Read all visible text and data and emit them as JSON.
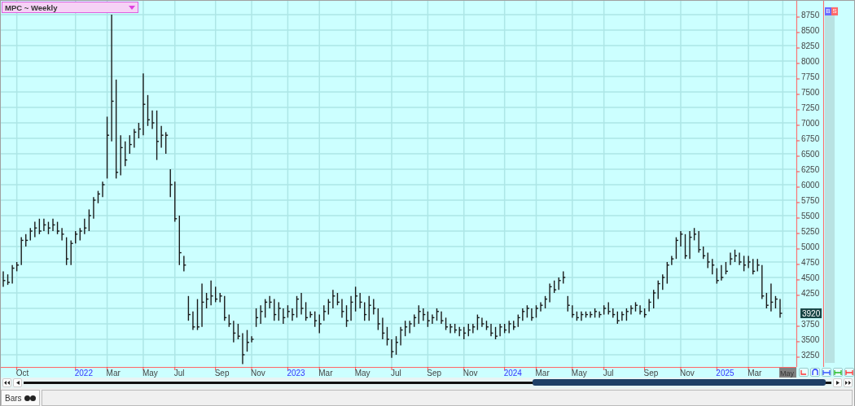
{
  "header": {
    "title": "MPC ~ Weekly"
  },
  "price_axis": [
    "8750",
    "8500",
    "8250",
    "8000",
    "7750",
    "7500",
    "7250",
    "7000",
    "6750",
    "6500",
    "6250",
    "6000",
    "5750",
    "5500",
    "5250",
    "5000",
    "4750",
    "4500",
    "4250",
    "3750",
    "3500",
    "3250"
  ],
  "time_axis": [
    {
      "label": "Oct",
      "kind": "month"
    },
    {
      "label": "2022",
      "kind": "year"
    },
    {
      "label": "Mar",
      "kind": "month"
    },
    {
      "label": "May",
      "kind": "month"
    },
    {
      "label": "Jul",
      "kind": "month"
    },
    {
      "label": "Sep",
      "kind": "month"
    },
    {
      "label": "Nov",
      "kind": "month"
    },
    {
      "label": "2023",
      "kind": "year"
    },
    {
      "label": "Mar",
      "kind": "month"
    },
    {
      "label": "May",
      "kind": "month"
    },
    {
      "label": "Jul",
      "kind": "month"
    },
    {
      "label": "Sep",
      "kind": "month"
    },
    {
      "label": "Nov",
      "kind": "month"
    },
    {
      "label": "2024",
      "kind": "year"
    },
    {
      "label": "Mar",
      "kind": "month"
    },
    {
      "label": "May",
      "kind": "month"
    },
    {
      "label": "Jul",
      "kind": "month"
    },
    {
      "label": "Sep",
      "kind": "month"
    },
    {
      "label": "Nov",
      "kind": "month"
    },
    {
      "label": "2025",
      "kind": "year"
    },
    {
      "label": "Mar",
      "kind": "month"
    },
    {
      "label": "May",
      "kind": "current"
    }
  ],
  "last_price": "3920",
  "signals": [
    {
      "label": "B",
      "color": "#6a6aff"
    },
    {
      "label": "S",
      "color": "#ff6a6a"
    }
  ],
  "status_tabs": [
    {
      "label": "Bars"
    }
  ]
}
